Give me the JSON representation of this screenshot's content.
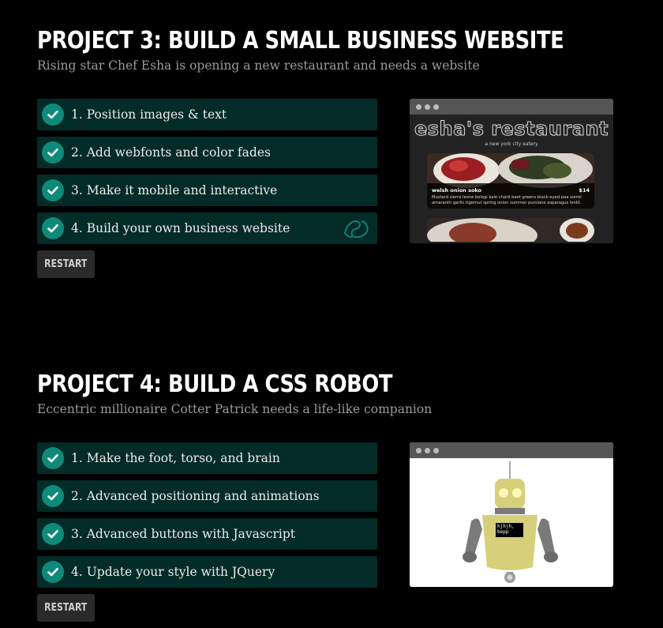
{
  "projects": [
    {
      "title": "PROJECT 3: BUILD A SMALL BUSINESS WEBSITE",
      "subtitle": "Rising star Chef Esha is opening a new restaurant and needs a website",
      "tasks": [
        {
          "label": "1. Position images & text",
          "completed": true
        },
        {
          "label": "2. Add webfonts and color fades",
          "completed": true
        },
        {
          "label": "3. Make it mobile and interactive",
          "completed": true
        },
        {
          "label": "4. Build your own business website",
          "completed": true,
          "icon": "badge-outline-icon"
        }
      ],
      "restart_label": "RESTART",
      "preview": {
        "site_title": "esha's restaurant",
        "tagline": "a new york city eatery",
        "dish_name": "welsh onion soko",
        "dish_price": "$14",
        "dish_description": "Mustard sierra leone bologi kale chard beet greens black-eyed pea sorrel amaranth garlic tigernut spring onion summer purslane asparagus lentil."
      }
    },
    {
      "title": "PROJECT 4: BUILD A CSS ROBOT",
      "subtitle": "Eccentric millionaire Cotter Patrick needs a life-like companion",
      "tasks": [
        {
          "label": "1. Make the foot, torso, and brain",
          "completed": true
        },
        {
          "label": "2. Advanced positioning and animations",
          "completed": true
        },
        {
          "label": "3. Advanced buttons with Javascript",
          "completed": true
        },
        {
          "label": "4. Update your style with JQuery",
          "completed": true
        }
      ],
      "restart_label": "RESTART",
      "preview": {
        "robot_screen_text": "hjhjh, bepp"
      }
    }
  ],
  "colors": {
    "background": "#000000",
    "task_background": "#032b27",
    "check_circle": "#0e8a7a",
    "subtitle": "#9a9a9a",
    "button_background": "#2a2a2a",
    "robot_yellow": "#d6d07a",
    "robot_gray": "#7a7a7a"
  }
}
